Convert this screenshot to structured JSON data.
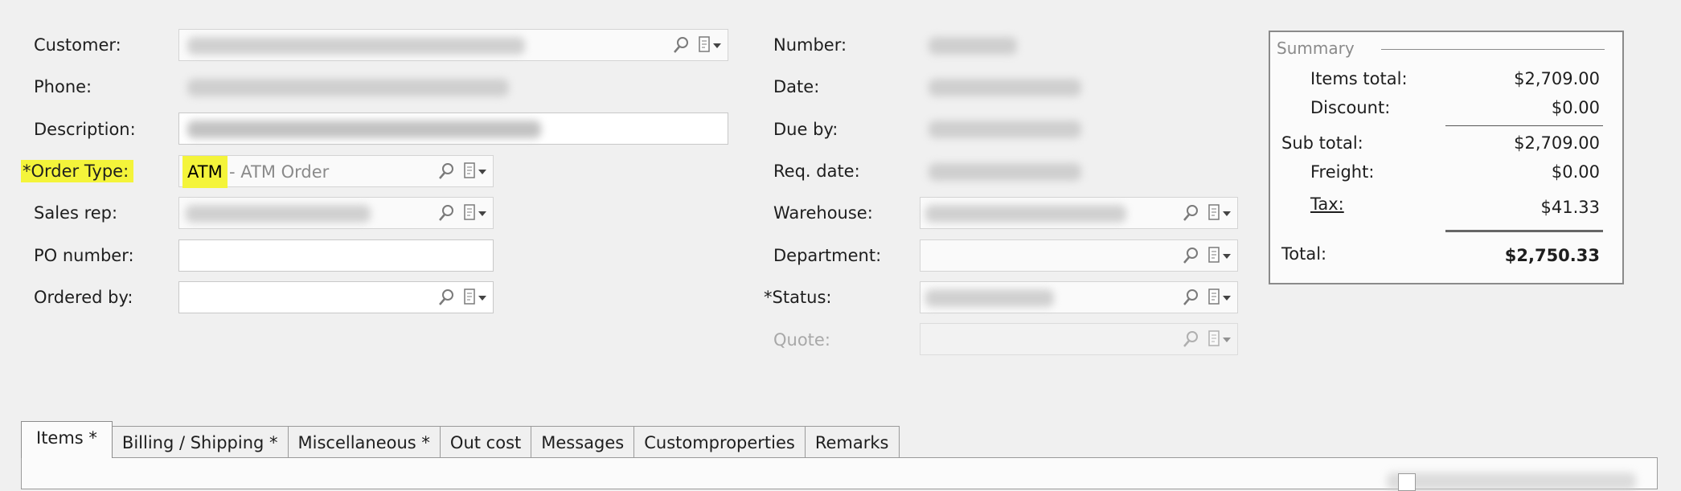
{
  "form": {
    "left_labels": {
      "customer": "Customer:",
      "phone": "Phone:",
      "description": "Description:",
      "order_type": "*Order Type:",
      "sales_rep": "Sales rep:",
      "po_number": "PO number:",
      "ordered_by": "Ordered by:"
    },
    "order_type": {
      "code": "ATM",
      "description": "- ATM Order"
    },
    "right_labels": {
      "number": "Number:",
      "date": "Date:",
      "due_by": "Due by:",
      "req_date": "Req. date:",
      "warehouse": "Warehouse:",
      "department": "Department:",
      "status": "*Status:",
      "quote": "Quote:"
    },
    "icons": {
      "lookup": "magnifier-icon",
      "picker": "picker-dropdown-icon"
    },
    "highlight_color": "#f4f43a"
  },
  "summary": {
    "legend": "Summary",
    "items_total_label": "Items total:",
    "items_total": "$2,709.00",
    "discount_label": "Discount:",
    "discount": "$0.00",
    "sub_total_label": "Sub total:",
    "sub_total": "$2,709.00",
    "freight_label": "Freight:",
    "freight": "$0.00",
    "tax_label": "Tax:",
    "tax": "$41.33",
    "total_label": "Total:",
    "total": "$2,750.33"
  },
  "tabs": [
    {
      "label": "Items *"
    },
    {
      "label": "Billing / Shipping *"
    },
    {
      "label": "Miscellaneous *"
    },
    {
      "label": "Out cost"
    },
    {
      "label": "Messages"
    },
    {
      "label": "Customproperties"
    },
    {
      "label": "Remarks"
    }
  ]
}
